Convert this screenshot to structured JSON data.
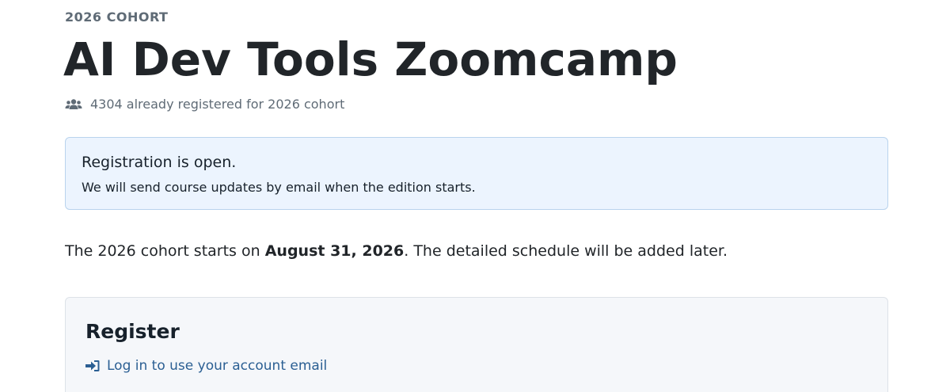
{
  "cohort": {
    "eyebrow": "2026 COHORT",
    "course_title": "AI Dev Tools Zoomcamp",
    "registered_text": "4304 already registered for 2026 cohort",
    "registered_icon": "users-icon"
  },
  "alert": {
    "title": "Registration is open.",
    "text": "We will send course updates by email when the edition starts."
  },
  "schedule": {
    "prefix": "The 2026 cohort starts on ",
    "start_date": "August 31, 2026",
    "suffix": ". The detailed schedule will be added later."
  },
  "register": {
    "title": "Register",
    "login_link": "Log in to use your account email",
    "login_icon": "sign-in-icon"
  },
  "colors": {
    "link": "#2b5f93",
    "alert_bg": "#ecf4fe",
    "card_bg": "#f5f7fa"
  }
}
